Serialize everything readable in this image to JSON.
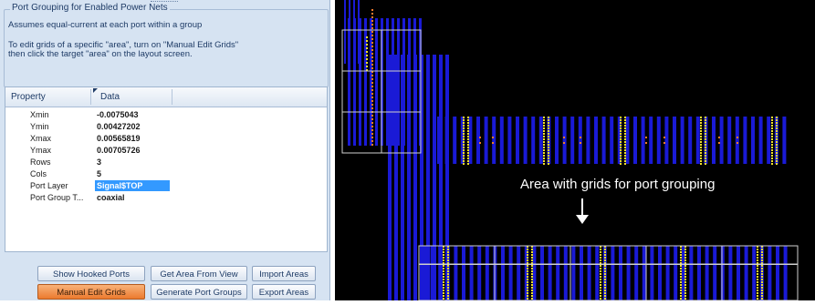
{
  "panel": {
    "group_title": "Port Grouping for Enabled Power Nets",
    "desc_line1": "Assumes equal-current at each port within a group",
    "desc_line2": "To edit grids of a specific \"area\", turn on \"Manual Edit Grids\"",
    "desc_line3": "then click the target \"area\" on the layout screen.",
    "table": {
      "header_property": "Property",
      "header_data": "Data",
      "rows": [
        {
          "property": "Xmin",
          "value": "-0.0075043"
        },
        {
          "property": "Ymin",
          "value": "0.00427202"
        },
        {
          "property": "Xmax",
          "value": "0.00565819"
        },
        {
          "property": "Ymax",
          "value": "0.00705726"
        },
        {
          "property": "Rows",
          "value": "3"
        },
        {
          "property": "Cols",
          "value": "5"
        },
        {
          "property": "Port Layer",
          "value": "Signal$TOP"
        },
        {
          "property": "Port Group T...",
          "value": "coaxial"
        }
      ]
    },
    "buttons": {
      "show_hooked_ports": "Show Hooked Ports",
      "get_area_from_view": "Get Area From View",
      "import_areas": "Import Areas",
      "manual_edit_grids": "Manual Edit Grids",
      "generate_port_groups": "Generate Port Groups",
      "export_areas": "Export Areas"
    }
  },
  "layout_view": {
    "annotation": "Area with grids for port grouping",
    "colors": {
      "background": "#000000",
      "trace": "#1a1ad6",
      "port_yellow": "#f2e02b",
      "port_orange": "#f07b2a",
      "grid": "#cfcfcf"
    }
  }
}
